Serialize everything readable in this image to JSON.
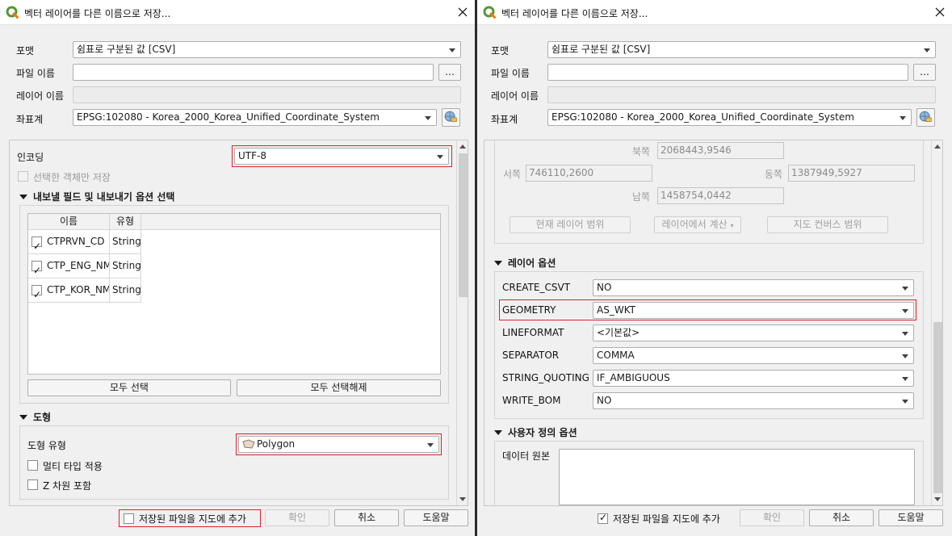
{
  "left_dialog": {
    "title": "벡터 레이어를 다른 이름으로 저장...",
    "format_label": "포맷",
    "format_value": "쉼표로 구분된 값 [CSV]",
    "filename_label": "파일 이름",
    "browse_label": "…",
    "layername_label": "레이어 이름",
    "crs_label": "좌표계",
    "crs_value": "EPSG:102080 - Korea_2000_Korea_Unified_Coordinate_System",
    "encoding_label": "인코딩",
    "encoding_value": "UTF-8",
    "selected_only_label": "선택한 객체만 저장",
    "fields_section_title": "내보낼 필드 및 내보내기 옵션 선택",
    "fields_table": {
      "headers": [
        "이름",
        "유형"
      ],
      "rows": [
        {
          "name": "CTPRVN_CD",
          "type": "String",
          "checked": true
        },
        {
          "name": "CTP_ENG_NM",
          "type": "String",
          "checked": true
        },
        {
          "name": "CTP_KOR_NM",
          "type": "String",
          "checked": true
        }
      ]
    },
    "select_all_label": "모두 선택",
    "deselect_all_label": "모두 선택해제",
    "geometry_section_title": "도형",
    "geometry_type_label": "도형 유형",
    "geometry_type_value": "Polygon",
    "multi_type_label": "멀티 타입 적용",
    "z_dimension_label": "Z 차원 포함",
    "add_to_map_label": "저장된 파일을 지도에 추가",
    "ok_label": "확인",
    "cancel_label": "취소",
    "help_label": "도움말"
  },
  "right_dialog": {
    "title": "벡터 레이어를 다른 이름으로 저장...",
    "format_label": "포맷",
    "format_value": "쉼표로 구분된 값 [CSV]",
    "filename_label": "파일 이름",
    "browse_label": "…",
    "layername_label": "레이어 이름",
    "crs_label": "좌표계",
    "crs_value": "EPSG:102080 - Korea_2000_Korea_Unified_Coordinate_System",
    "extent": {
      "north_label": "북쪽",
      "north_value": "2068443,9546",
      "west_label": "서쪽",
      "west_value": "746110,2600",
      "east_label": "동쪽",
      "east_value": "1387949,5927",
      "south_label": "남쪽",
      "south_value": "1458754,0442",
      "current_layer_btn": "현재 레이어 범위",
      "calc_from_layer_btn": "레이어에서 계산",
      "map_canvas_btn": "지도 컨버스 범위"
    },
    "layer_options_title": "레이어 옵션",
    "layer_options": [
      {
        "key": "CREATE_CSVT",
        "value": "NO"
      },
      {
        "key": "GEOMETRY",
        "value": "AS_WKT"
      },
      {
        "key": "LINEFORMAT",
        "value": "<기본값>"
      },
      {
        "key": "SEPARATOR",
        "value": "COMMA"
      },
      {
        "key": "STRING_QUOTING",
        "value": "IF_AMBIGUOUS"
      },
      {
        "key": "WRITE_BOM",
        "value": "NO"
      }
    ],
    "custom_options_title": "사용자 정의 옵션",
    "data_source_label": "데이터 원본",
    "add_to_map_label": "저장된 파일을 지도에 추가",
    "add_to_map_checked": true,
    "ok_label": "확인",
    "cancel_label": "취소",
    "help_label": "도움말"
  },
  "colors": {
    "highlight_frame": "#d8232a",
    "qgis_green": "#589632"
  }
}
